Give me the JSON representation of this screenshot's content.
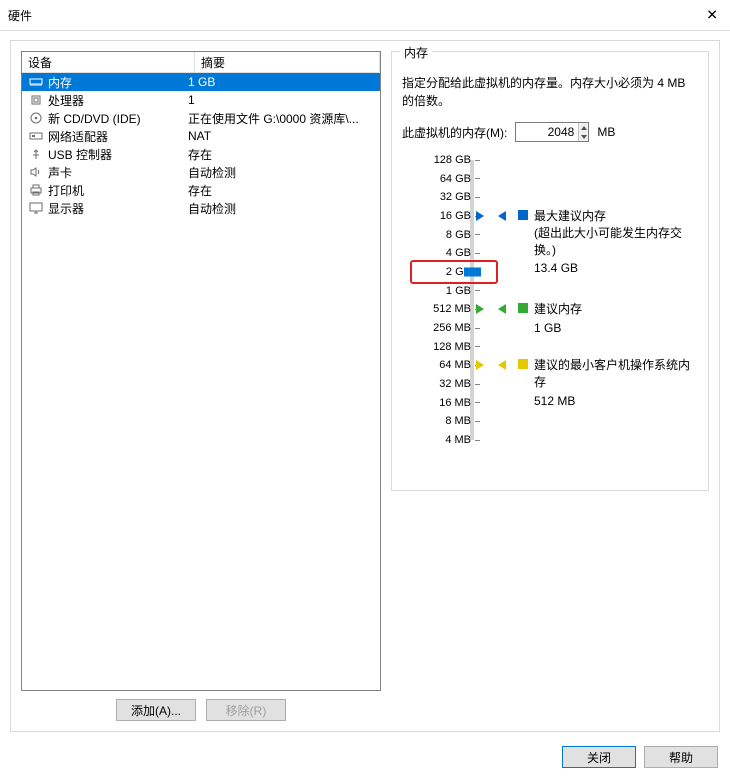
{
  "window": {
    "title": "硬件"
  },
  "columns": {
    "device": "设备",
    "summary": "摘要"
  },
  "devices": [
    {
      "key": "memory",
      "name": "内存",
      "summary": "1 GB",
      "selected": true
    },
    {
      "key": "cpu",
      "name": "处理器",
      "summary": "1",
      "selected": false
    },
    {
      "key": "cd",
      "name": "新 CD/DVD (IDE)",
      "summary": "正在使用文件 G:\\0000 资源库\\...",
      "selected": false
    },
    {
      "key": "nic",
      "name": "网络适配器",
      "summary": "NAT",
      "selected": false
    },
    {
      "key": "usb",
      "name": "USB 控制器",
      "summary": "存在",
      "selected": false
    },
    {
      "key": "sound",
      "name": "声卡",
      "summary": "自动检测",
      "selected": false
    },
    {
      "key": "printer",
      "name": "打印机",
      "summary": "存在",
      "selected": false
    },
    {
      "key": "display",
      "name": "显示器",
      "summary": "自动检测",
      "selected": false
    }
  ],
  "left_buttons": {
    "add": "添加(A)...",
    "remove": "移除(R)"
  },
  "memory_panel": {
    "legend": "内存",
    "description": "指定分配给此虚拟机的内存量。内存大小必须为 4 MB 的倍数。",
    "field_label": "此虚拟机的内存(M):",
    "value": "2048",
    "unit": "MB",
    "scale": [
      "128 GB",
      "64 GB",
      "32 GB",
      "16 GB",
      "8 GB",
      "4 GB",
      "2 GB",
      "1 GB",
      "512 MB",
      "256 MB",
      "128 MB",
      "64 MB",
      "32 MB",
      "16 MB",
      "8 MB",
      "4 MB"
    ],
    "thumb_at": "2 GB",
    "highlight_at": "2 GB",
    "markers": {
      "max": {
        "at": "16 GB",
        "title": "最大建议内存",
        "note": "(超出此大小可能发生内存交换。)",
        "value": "13.4 GB",
        "color": "#0066cc"
      },
      "rec": {
        "at": "512 MB",
        "title": "建议内存",
        "value": "1 GB",
        "color": "#33aa33"
      },
      "min": {
        "at": "64 MB",
        "title": "建议的最小客户机操作系统内存",
        "value": "512 MB",
        "color": "#e6c700"
      }
    }
  },
  "footer": {
    "close": "关闭",
    "help": "帮助"
  }
}
